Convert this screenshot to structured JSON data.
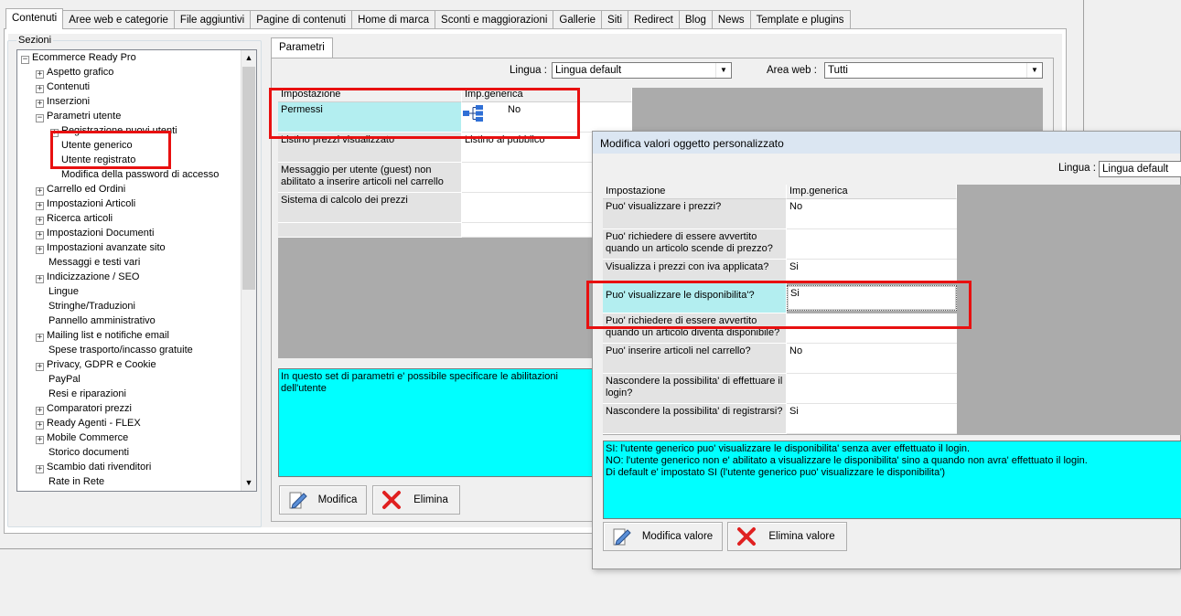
{
  "top_tabs": [
    "Contenuti",
    "Aree web e categorie",
    "File aggiuntivi",
    "Pagine di contenuti",
    "Home di marca",
    "Sconti e maggiorazioni",
    "Gallerie",
    "Siti",
    "Redirect",
    "Blog",
    "News",
    "Template e plugins"
  ],
  "sections_title": "Sezioni",
  "tree": [
    {
      "label": "Ecommerce Ready Pro",
      "exp": "-"
    },
    {
      "label": "Aspetto grafico",
      "exp": "+"
    },
    {
      "label": "Contenuti",
      "exp": "+"
    },
    {
      "label": "Inserzioni",
      "exp": "+"
    },
    {
      "label": "Parametri utente",
      "exp": "-"
    },
    {
      "label": "Registrazione nuovi utenti",
      "exp": "+"
    },
    {
      "label": "Utente generico",
      "exp": ""
    },
    {
      "label": "Utente registrato",
      "exp": ""
    },
    {
      "label": "Modifica della password di accesso",
      "exp": ""
    },
    {
      "label": "Carrello ed Ordini",
      "exp": "+"
    },
    {
      "label": "Impostazioni Articoli",
      "exp": "+"
    },
    {
      "label": "Ricerca articoli",
      "exp": "+"
    },
    {
      "label": "Impostazioni Documenti",
      "exp": "+"
    },
    {
      "label": "Impostazioni avanzate sito",
      "exp": "+"
    },
    {
      "label": "Messaggi e testi vari",
      "exp": ""
    },
    {
      "label": "Indicizzazione / SEO",
      "exp": "+"
    },
    {
      "label": "Lingue",
      "exp": ""
    },
    {
      "label": "Stringhe/Traduzioni",
      "exp": ""
    },
    {
      "label": "Pannello amministrativo",
      "exp": ""
    },
    {
      "label": "Mailing list e notifiche email",
      "exp": "+"
    },
    {
      "label": "Spese trasporto/incasso gratuite",
      "exp": ""
    },
    {
      "label": "Privacy, GDPR e Cookie",
      "exp": "+"
    },
    {
      "label": "PayPal",
      "exp": ""
    },
    {
      "label": "Resi e riparazioni",
      "exp": ""
    },
    {
      "label": "Comparatori prezzi",
      "exp": "+"
    },
    {
      "label": "Ready Agenti - FLEX",
      "exp": "+"
    },
    {
      "label": "Mobile Commerce",
      "exp": "+"
    },
    {
      "label": "Storico documenti",
      "exp": ""
    },
    {
      "label": "Scambio dati rivenditori",
      "exp": "+"
    },
    {
      "label": "Rate in Rete",
      "exp": ""
    }
  ],
  "params": {
    "tab_label": "Parametri",
    "lingua_label": "Lingua :",
    "lingua_value": "Lingua default",
    "area_label": "Area web :",
    "area_value": "Tutti",
    "col_setting": "Impostazione",
    "col_value": "Imp.generica",
    "rows": [
      {
        "key": "Permessi",
        "value": "No"
      },
      {
        "key": "Listino prezzi visualizzato",
        "value": "Listino al pubblico"
      },
      {
        "key": "Messaggio per utente (guest) non abilitato a inserire articoli nel carrello",
        "value": ""
      },
      {
        "key": "Sistema di calcolo dei prezzi",
        "value": ""
      },
      {
        "key": "",
        "value": ""
      }
    ],
    "description": "In questo set di parametri e' possibile specificare le abilitazioni dell'utente",
    "btn_edit": "Modifica",
    "btn_delete": "Elimina"
  },
  "dialog": {
    "title": "Modifica valori oggetto personalizzato",
    "lingua_label": "Lingua :",
    "lingua_value": "Lingua default",
    "col_setting": "Impostazione",
    "col_value": "Imp.generica",
    "rows": [
      {
        "key": "Puo' visualizzare i prezzi?",
        "value": "No"
      },
      {
        "key": "Puo' richiedere di essere avvertito quando un articolo scende di prezzo?",
        "value": ""
      },
      {
        "key": "Visualizza i prezzi con iva applicata?",
        "value": "Si"
      },
      {
        "key": "Puo' visualizzare le disponibilita'?",
        "value": "Si"
      },
      {
        "key": "Puo' richiedere di essere avvertito quando un articolo diventa disponibile?",
        "value": ""
      },
      {
        "key": "Puo' inserire articoli nel carrello?",
        "value": "No"
      },
      {
        "key": "Nascondere la possibilita' di effettuare il login?",
        "value": ""
      },
      {
        "key": "Nascondere la possibilita' di registrarsi?",
        "value": "Si"
      }
    ],
    "description_lines": [
      "SI: l'utente generico puo' visualizzare le disponibilita' senza aver effettuato il login.",
      "NO: l'utente generico non e' abilitato a visualizzare le disponibilita' sino a quando non avra' effettuato il login.",
      "Di default e' impostato SI (l'utente generico puo' visualizzare le disponibilita')"
    ],
    "btn_edit": "Modifica valore",
    "btn_delete": "Elimina valore"
  },
  "colors": {
    "highlight": "#e81010",
    "selection": "#b3eef0",
    "description_bg": "#00ffff"
  }
}
